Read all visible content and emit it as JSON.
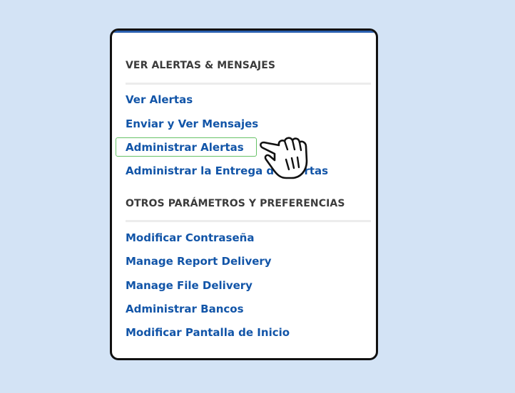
{
  "sections": [
    {
      "heading": "VER ALERTAS & MENSAJES",
      "links": [
        {
          "label": "Ver Alertas"
        },
        {
          "label": "Enviar y Ver Mensajes"
        },
        {
          "label": "Administrar Alertas",
          "highlighted": true
        },
        {
          "label": "Administrar la Entrega de Alertas"
        }
      ]
    },
    {
      "heading": "OTROS PARÁMETROS Y PREFERENCIAS",
      "links": [
        {
          "label": "Modificar Contraseña"
        },
        {
          "label": "Manage Report Delivery"
        },
        {
          "label": "Manage File Delivery"
        },
        {
          "label": "Administrar Bancos"
        },
        {
          "label": "Modificar Pantalla de Inicio"
        }
      ]
    }
  ],
  "cursor": {
    "icon": "hand-pointer-icon"
  },
  "colors": {
    "background": "#d3e3f5",
    "link": "#1255a8",
    "heading": "#3b3b3b",
    "highlight_border": "#66c266",
    "panel_border": "#111111"
  }
}
